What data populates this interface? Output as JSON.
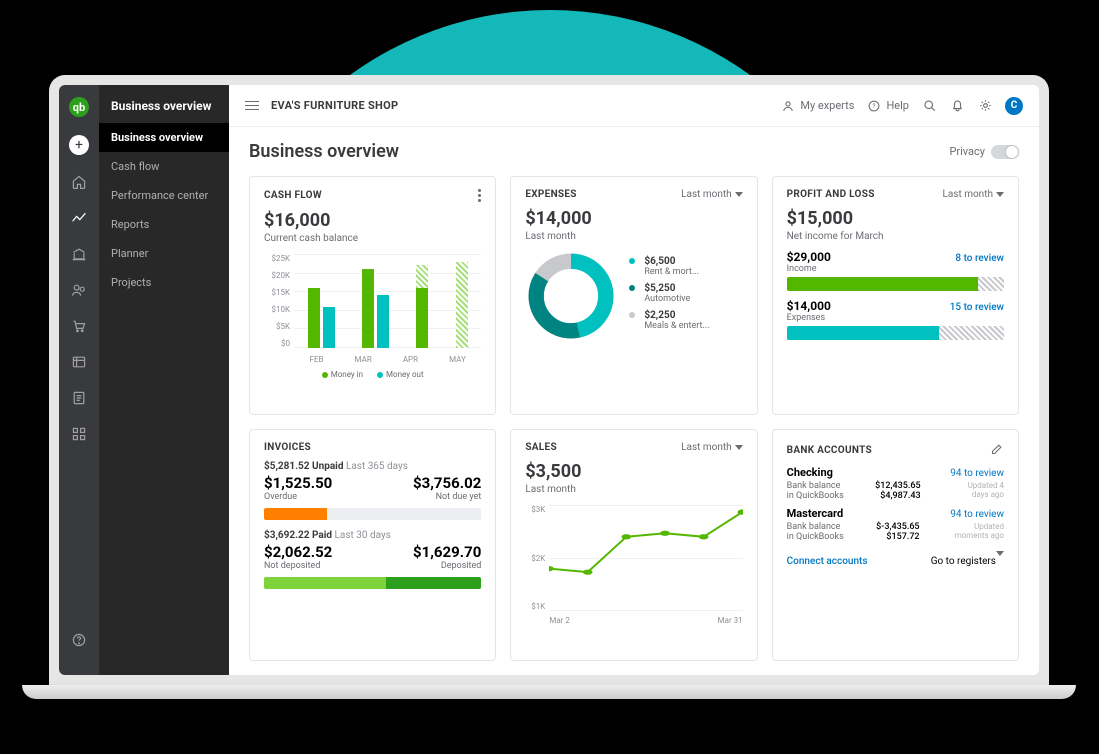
{
  "company": "EVA'S FURNITURE SHOP",
  "topbar": {
    "experts": "My experts",
    "help": "Help",
    "avatar": "C"
  },
  "page": {
    "title": "Business overview",
    "privacy": "Privacy"
  },
  "sidenav": {
    "header": "Business overview",
    "items": [
      "Business overview",
      "Cash flow",
      "Performance center",
      "Reports",
      "Planner",
      "Projects"
    ],
    "selected": 0
  },
  "cards": {
    "cashflow": {
      "title": "CASH FLOW",
      "amount": "$16,000",
      "sub": "Current cash balance",
      "legend": {
        "in": "Money in",
        "out": "Money out"
      }
    },
    "expenses": {
      "title": "EXPENSES",
      "range": "Last month",
      "amount": "$14,000",
      "sub": "Last month",
      "items": [
        {
          "color": "#00c1bf",
          "val": "$6,500",
          "lbl": "Rent & mort..."
        },
        {
          "color": "#008481",
          "val": "$5,250",
          "lbl": "Automotive"
        },
        {
          "color": "#c7c9cc",
          "val": "$2,250",
          "lbl": "Meals & entert..."
        }
      ]
    },
    "pl": {
      "title": "PROFIT AND LOSS",
      "range": "Last month",
      "amount": "$15,000",
      "sub": "Net income for March",
      "rows": [
        {
          "amt": "$29,000",
          "sub": "Income",
          "rev": "8 to review",
          "fill": 88,
          "color": "f1"
        },
        {
          "amt": "$14,000",
          "sub": "Expenses",
          "rev": "15 to review",
          "fill": 70,
          "color": "f2"
        }
      ]
    },
    "invoices": {
      "title": "INVOICES",
      "unpaid": {
        "line1_a": "$5,281.52 Unpaid",
        "line1_b": "Last 365 days",
        "overdue": "$1,525.50",
        "overdue_l": "Overdue",
        "notdue": "$3,756.02",
        "notdue_l": "Not due yet",
        "pct": 29
      },
      "paid": {
        "line1_a": "$3,692.22 Paid",
        "line1_b": "Last 30 days",
        "notdep": "$2,062.52",
        "notdep_l": "Not deposited",
        "dep": "$1,629.70",
        "dep_l": "Deposited",
        "pct": 56
      }
    },
    "sales": {
      "title": "SALES",
      "range": "Last month",
      "amount": "$3,500",
      "sub": "Last month",
      "ylabels": [
        "$3K",
        "$2K",
        "$1K"
      ],
      "xlabels": [
        "Mar 2",
        "Mar 31"
      ]
    },
    "bank": {
      "title": "BANK ACCOUNTS",
      "accounts": [
        {
          "name": "Checking",
          "rev": "94 to review",
          "bal": "$12,435.65",
          "qb": "$4,987.43",
          "upd": "Updated 4 days ago"
        },
        {
          "name": "Mastercard",
          "rev": "94 to review",
          "bal": "$-3,435.65",
          "qb": "$157.72",
          "upd": "Updated moments ago"
        }
      ],
      "labels": {
        "bb": "Bank balance",
        "qb": "in QuickBooks"
      },
      "connect": "Connect accounts",
      "registers": "Go to registers"
    }
  },
  "chart_data": {
    "cashflow": {
      "type": "bar",
      "ylim": 25,
      "yticks": [
        "$25K",
        "$20K",
        "$15K",
        "$10K",
        "$5K",
        "$0"
      ],
      "months": [
        "FEB",
        "MAR",
        "APR",
        "MAY"
      ],
      "series": [
        {
          "name": "Money in",
          "values": [
            16,
            21,
            22,
            23
          ],
          "proj": [
            0,
            0,
            6,
            23
          ]
        },
        {
          "name": "Money out",
          "values": [
            11,
            14,
            0,
            0
          ]
        }
      ]
    },
    "expenses": {
      "type": "pie",
      "values": [
        6500,
        5250,
        2250
      ],
      "labels": [
        "Rent & mort...",
        "Automotive",
        "Meals & entert..."
      ],
      "colors": [
        "#00c1bf",
        "#008481",
        "#c7c9cc"
      ]
    },
    "sales": {
      "type": "line",
      "ylim": 3,
      "x": [
        0,
        1,
        2,
        3,
        4,
        5
      ],
      "y": [
        1.2,
        1.1,
        2.1,
        2.2,
        2.1,
        2.8
      ]
    }
  }
}
